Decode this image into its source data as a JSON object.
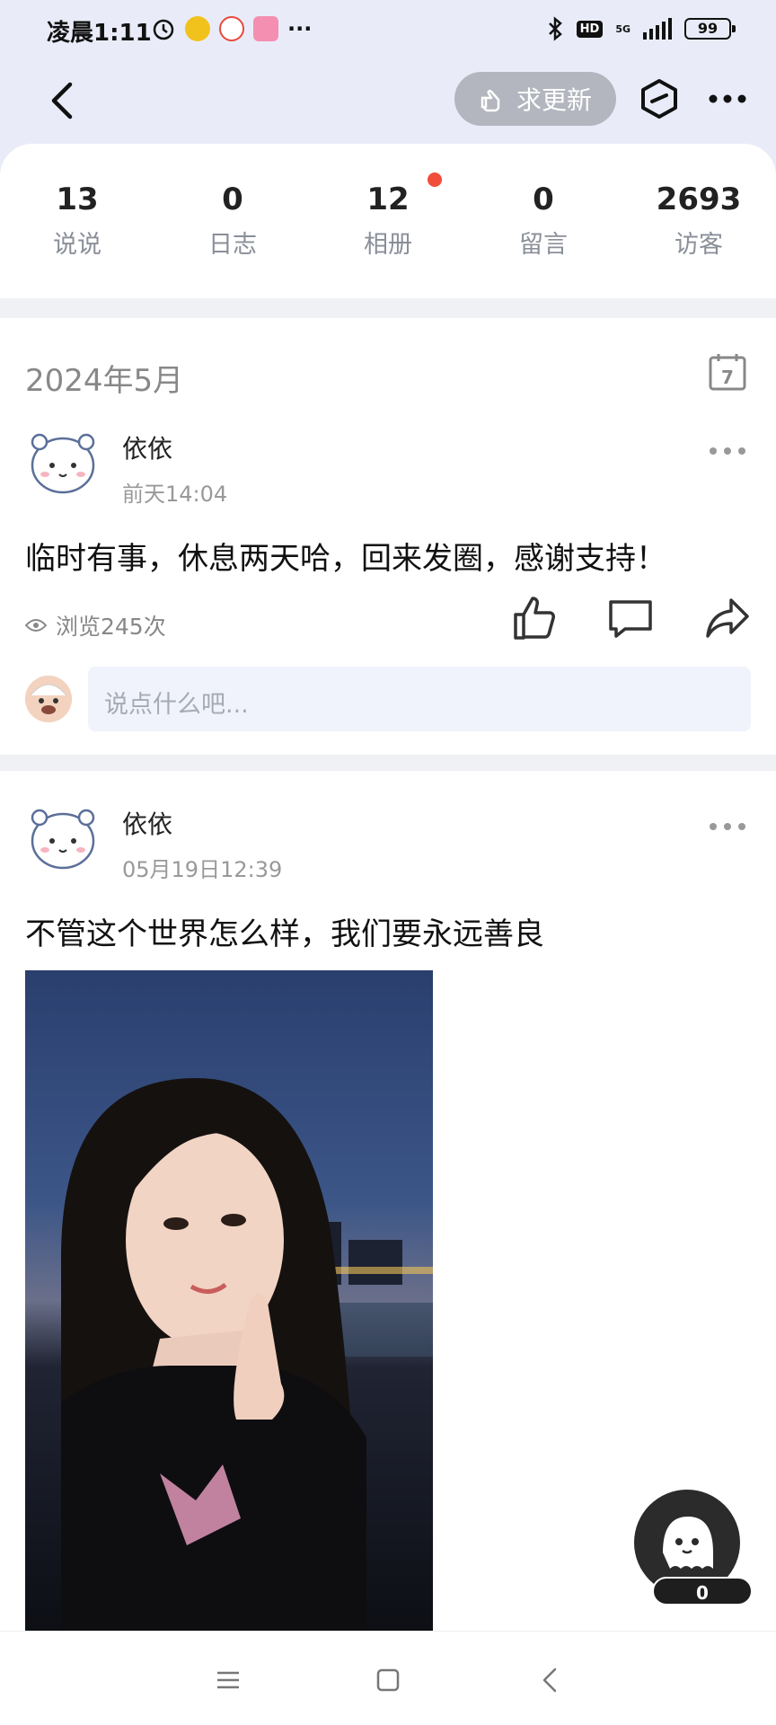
{
  "status_bar": {
    "time": "凌晨1:11",
    "battery": "99",
    "hd": "HD",
    "network": "5G"
  },
  "header": {
    "request_update_label": "求更新"
  },
  "stats": [
    {
      "value": "13",
      "label": "说说"
    },
    {
      "value": "0",
      "label": "日志"
    },
    {
      "value": "12",
      "label": "相册"
    },
    {
      "value": "0",
      "label": "留言"
    },
    {
      "value": "2693",
      "label": "访客"
    }
  ],
  "feed": {
    "month_label": "2024年5月",
    "calendar_day": "7",
    "posts": [
      {
        "author": "依依",
        "time": "前天14:04",
        "text": "临时有事，休息两天哈，回来发圈，感谢支持！",
        "views": "浏览245次"
      },
      {
        "author": "依依",
        "time": "05月19日12:39",
        "text": "不管这个世界怎么样，我们要永远善良"
      }
    ],
    "comment_placeholder": "说点什么吧..."
  },
  "float_button": {
    "count": "0"
  },
  "colors": {
    "header_bg": "#e9ecf8",
    "accent_red": "#f24d3a",
    "request_btn": "#b3b6be",
    "comment_bg": "#f0f3fb"
  },
  "icons": [
    "back-icon",
    "hand-pointer-icon",
    "cube-icon",
    "more-icon",
    "calendar-icon",
    "eye-icon",
    "thumbs-up-icon",
    "comment-icon",
    "share-icon",
    "menu-icon",
    "home-icon",
    "nav-back-icon"
  ]
}
